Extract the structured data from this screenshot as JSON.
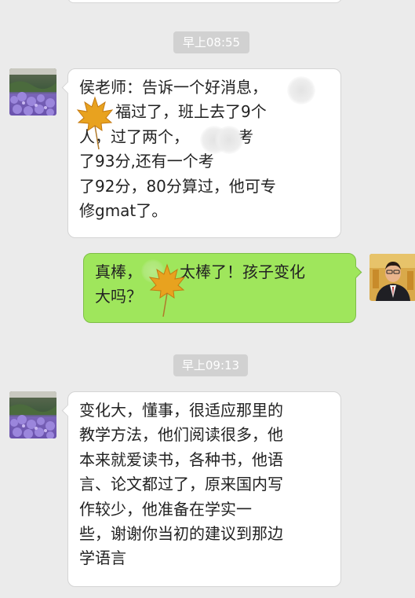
{
  "chat": {
    "timestamps": [
      "早上08:55",
      "早上09:13"
    ],
    "messages": [
      {
        "side": "left",
        "lines": [
          "侯老师：告诉一个好消息，",
          "福过了，班上去了9个",
          "人，过了两个，",
          "考",
          "了93分,还有一个考",
          "了92分，80分算过，他可专",
          "修gmat了。"
        ]
      },
      {
        "side": "right",
        "lines": [
          "真棒，",
          "太棒了！孩子变化",
          "大吗？"
        ]
      },
      {
        "side": "left",
        "lines": [
          "变化大，懂事，很适应那里的",
          "教学方法，他们阅读很多，他",
          "本来就爱读书，各种书，他语",
          "言、论文都过了，原来国内写",
          "作较少，他准备在学实一",
          "些，谢谢你当初的建议到那边",
          "学语言"
        ]
      }
    ]
  },
  "colors": {
    "background": "#ebebeb",
    "sent_bubble": "#9fe65c",
    "received_bubble": "#ffffff",
    "time_pill": "#d1d1d1"
  },
  "icons": {
    "redaction_sticker": "maple-leaf-icon",
    "left_avatar": "lavender-field-avatar",
    "right_avatar": "man-in-suit-avatar"
  }
}
